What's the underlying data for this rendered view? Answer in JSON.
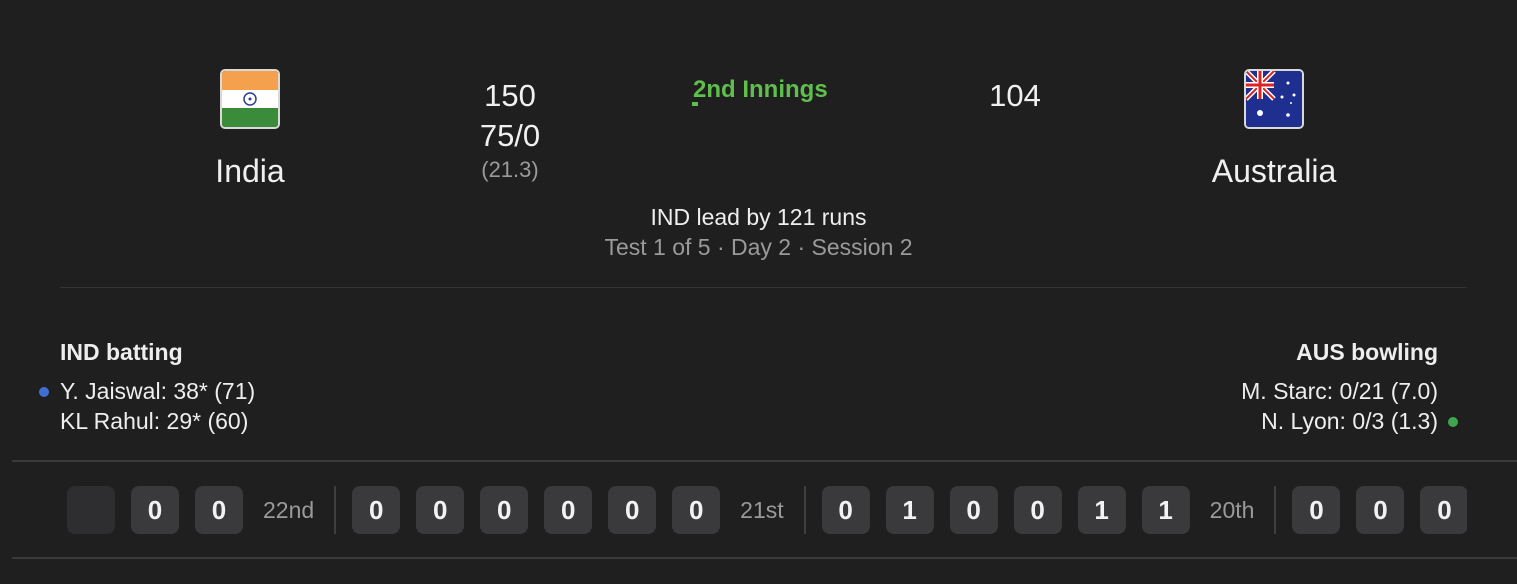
{
  "home": {
    "name": "India",
    "score": "150",
    "score2": "75/0",
    "overs": "(21.3)"
  },
  "away": {
    "name": "Australia",
    "score": "104"
  },
  "match": {
    "innings_label": "2nd Innings",
    "lead_text": "IND lead by 121 runs",
    "meta_text": "Test 1 of 5 · Day 2 · Session 2"
  },
  "batting": {
    "title": "IND batting",
    "players": [
      "Y. Jaiswal: 38* (71)",
      "KL Rahul: 29* (60)"
    ],
    "striker_color": "#3f6fd6"
  },
  "bowling": {
    "title": "AUS bowling",
    "players": [
      "M. Starc: 0/21 (7.0)",
      "N. Lyon: 0/3 (1.3)"
    ],
    "current_color": "#3fa650"
  },
  "overs_strip": [
    {
      "label": "22nd",
      "balls": [
        "",
        "0",
        "0"
      ]
    },
    {
      "label": "21st",
      "balls": [
        "0",
        "0",
        "0",
        "0",
        "0",
        "0"
      ]
    },
    {
      "label": "20th",
      "balls": [
        "0",
        "1",
        "0",
        "0",
        "1",
        "1"
      ]
    },
    {
      "label": "",
      "balls": [
        "0",
        "0",
        "0"
      ]
    }
  ],
  "colors": {
    "background": "#1f1f1f",
    "accent_green": "#5fbf4d",
    "ball_bg": "#3a3a3c"
  },
  "icons": {
    "home_flag": "india-flag-icon",
    "away_flag": "australia-flag-icon"
  }
}
